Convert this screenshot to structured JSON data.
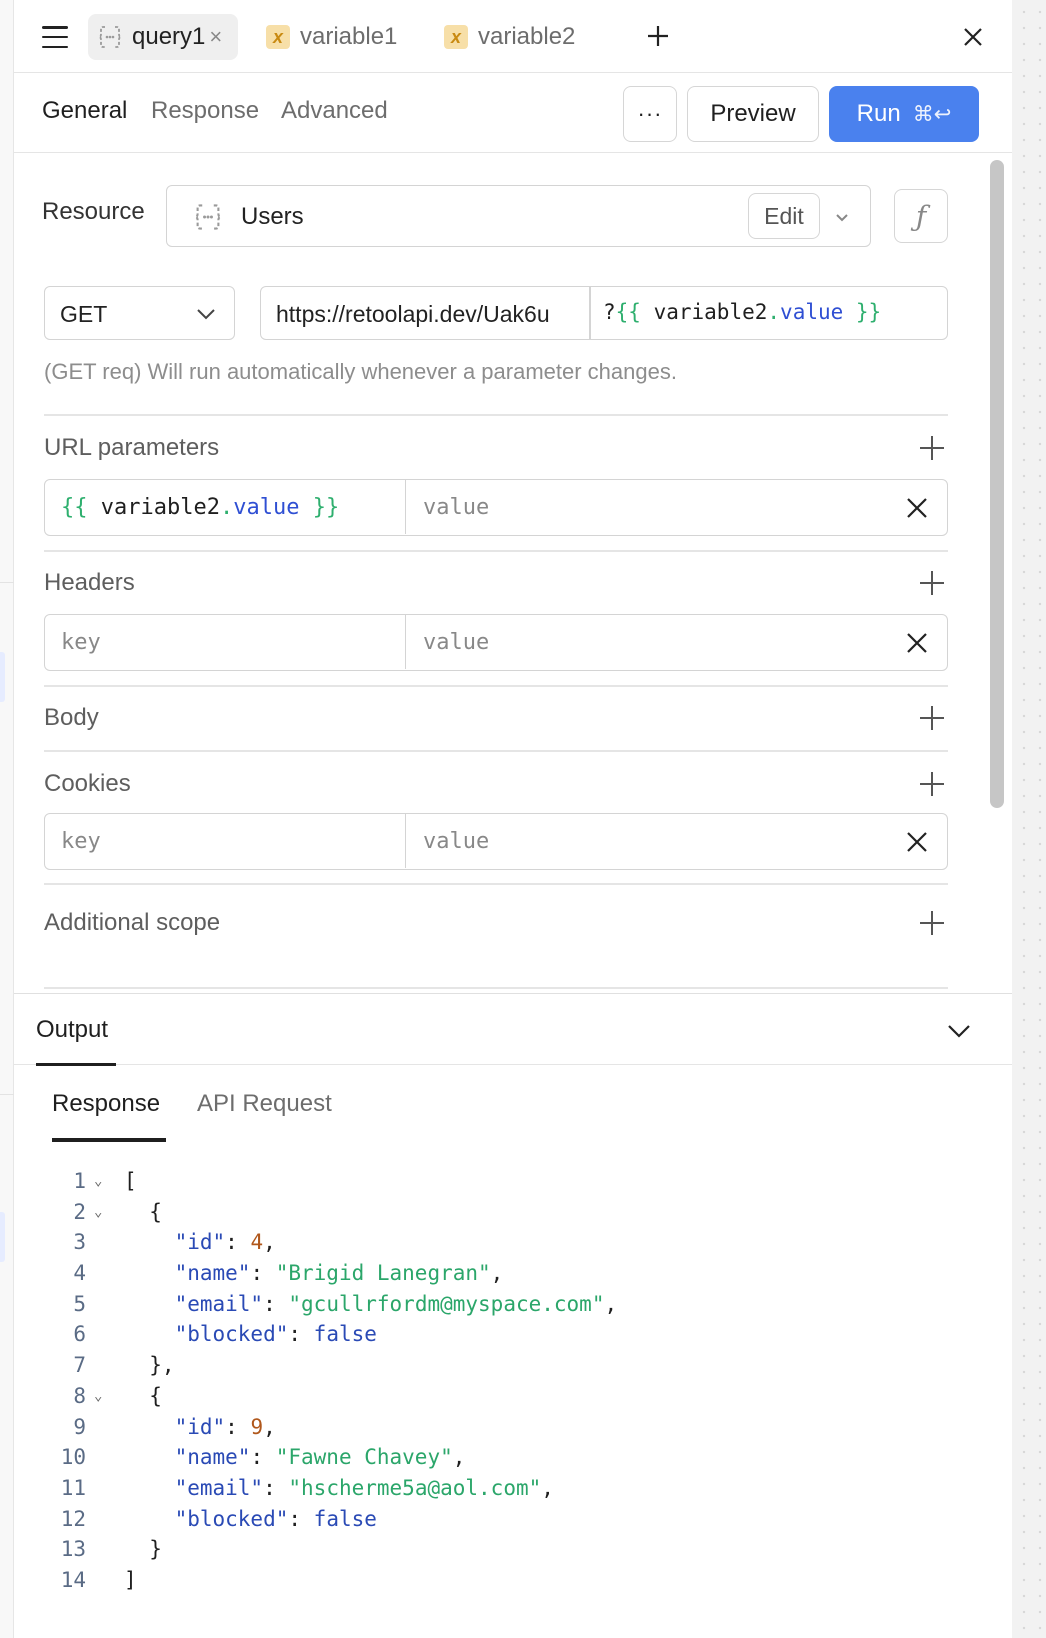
{
  "tabs": [
    {
      "label": "query1",
      "type": "query",
      "active": true
    },
    {
      "label": "variable1",
      "type": "variable",
      "active": false
    },
    {
      "label": "variable2",
      "type": "variable",
      "active": false
    }
  ],
  "subtabs": {
    "general": "General",
    "response": "Response",
    "advanced": "Advanced"
  },
  "actions": {
    "more": "···",
    "preview": "Preview",
    "run": "Run",
    "run_shortcut": "⌘↩"
  },
  "resource": {
    "label": "Resource",
    "name": "Users",
    "edit": "Edit",
    "fx": "ƒ"
  },
  "request": {
    "method": "GET",
    "url": "https://retoolapi.dev/Uak6u",
    "query_prefix": "?",
    "query_template": {
      "open": "{{ ",
      "var": "variable2",
      "dot": ".",
      "prop": "value",
      "close": " }}"
    },
    "hint": "(GET req) Will run automatically whenever a parameter changes."
  },
  "sections": {
    "url_params": "URL parameters",
    "headers": "Headers",
    "body": "Body",
    "cookies": "Cookies",
    "additional_scope": "Additional scope"
  },
  "url_param_row": {
    "key_template": {
      "open": "{{ ",
      "var": "variable2",
      "dot": ".",
      "prop": "value",
      "close": " }}"
    },
    "value_placeholder": "value"
  },
  "headers_row": {
    "key_placeholder": "key",
    "value_placeholder": "value"
  },
  "cookies_row": {
    "key_placeholder": "key",
    "value_placeholder": "value"
  },
  "output": {
    "title": "Output",
    "tabs": {
      "response": "Response",
      "api_request": "API Request"
    },
    "lines": [
      {
        "n": "1",
        "fold": true,
        "text": "["
      },
      {
        "n": "2",
        "fold": true,
        "text": "  {"
      },
      {
        "n": "3",
        "key": "\"id\"",
        "num": "4",
        "tail": ","
      },
      {
        "n": "4",
        "key": "\"name\"",
        "str": "\"Brigid Lanegran\"",
        "tail": ","
      },
      {
        "n": "5",
        "key": "\"email\"",
        "str": "\"gcullrfordm@myspace.com\"",
        "tail": ","
      },
      {
        "n": "6",
        "key": "\"blocked\"",
        "bool": "false",
        "tail": ""
      },
      {
        "n": "7",
        "text": "  },"
      },
      {
        "n": "8",
        "fold": true,
        "text": "  {"
      },
      {
        "n": "9",
        "key": "\"id\"",
        "num": "9",
        "tail": ","
      },
      {
        "n": "10",
        "key": "\"name\"",
        "str": "\"Fawne Chavey\"",
        "tail": ","
      },
      {
        "n": "11",
        "key": "\"email\"",
        "str": "\"hscherme5a@aol.com\"",
        "tail": ","
      },
      {
        "n": "12",
        "key": "\"blocked\"",
        "bool": "false",
        "tail": ""
      },
      {
        "n": "13",
        "text": "  }"
      },
      {
        "n": "14",
        "text": "]"
      }
    ]
  },
  "colors": {
    "accent": "#4a81ee",
    "template_green": "#2eaf6e",
    "template_blue": "#2f4fd3",
    "variable_badge": "#f7dfa8"
  }
}
